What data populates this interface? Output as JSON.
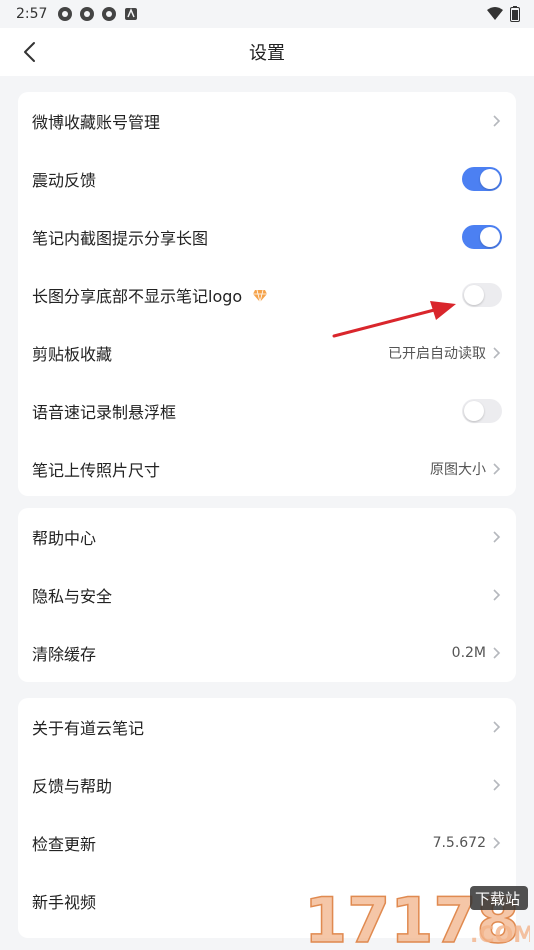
{
  "status_bar": {
    "time": "2:57"
  },
  "header": {
    "title": "设置"
  },
  "group1": [
    {
      "label": "微博收藏账号管理",
      "type": "link"
    },
    {
      "label": "震动反馈",
      "type": "toggle",
      "on": true
    },
    {
      "label": "笔记内截图提示分享长图",
      "type": "toggle",
      "on": true
    },
    {
      "label": "长图分享底部不显示笔记logo",
      "type": "toggle",
      "on": false,
      "vip": true
    },
    {
      "label": "剪贴板收藏",
      "type": "link",
      "value": "已开启自动读取"
    },
    {
      "label": "语音速记录制悬浮框",
      "type": "toggle",
      "on": false
    },
    {
      "label": "笔记上传照片尺寸",
      "type": "link",
      "value": "原图大小"
    }
  ],
  "group2": [
    {
      "label": "帮助中心",
      "type": "link"
    },
    {
      "label": "隐私与安全",
      "type": "link"
    },
    {
      "label": "清除缓存",
      "type": "link",
      "value": "0.2M"
    }
  ],
  "group3": [
    {
      "label": "关于有道云笔记",
      "type": "link"
    },
    {
      "label": "反馈与帮助",
      "type": "link"
    },
    {
      "label": "检查更新",
      "type": "link",
      "value": "7.5.672"
    },
    {
      "label": "新手视频",
      "type": "link"
    }
  ],
  "watermark": {
    "text": "17178",
    "badge": "下载站",
    "suffix": ".COM"
  },
  "colors": {
    "toggle_on": "#4c80f2",
    "toggle_off": "#ececef",
    "background": "#f4f5f7",
    "arrow": "#d9262c"
  }
}
